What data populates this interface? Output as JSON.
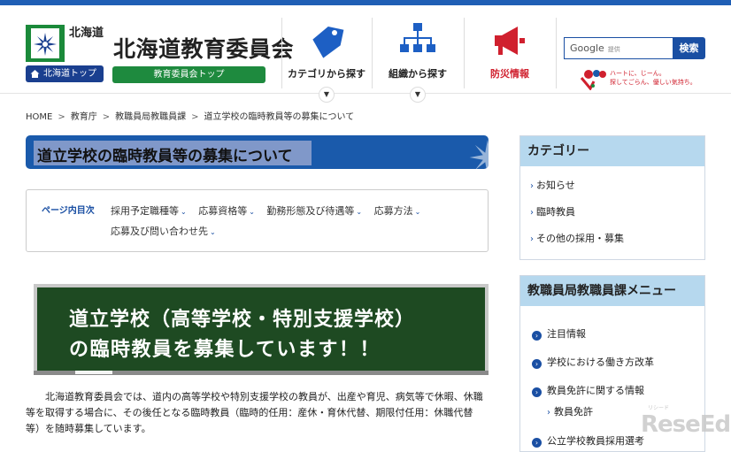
{
  "header": {
    "pref_name": "北海道",
    "pref_top_label": "北海道トップ",
    "board_title": "北海道教育委員会",
    "board_top_label": "教育委員会トップ",
    "nav": [
      {
        "label": "カテゴリから探す",
        "icon": "tag-icon"
      },
      {
        "label": "組織から探す",
        "icon": "org-chart-icon"
      },
      {
        "label": "防災情報",
        "icon": "megaphone-icon"
      }
    ],
    "search": {
      "brand": "Google",
      "brand_sub": "提供",
      "button_label": "検索"
    },
    "heart_line1": "ハートに、じーん。",
    "heart_line2": "探してごらん、優しい気持ち。"
  },
  "breadcrumb": [
    "HOME",
    "教育庁",
    "教職員局教職員課",
    "道立学校の臨時教員等の募集について"
  ],
  "page_title": "道立学校の臨時教員等の募集について",
  "toc": {
    "lead": "ページ内目次",
    "items": [
      "採用予定職種等",
      "応募資格等",
      "勤務形態及び待遇等",
      "応募方法",
      "応募及び問い合わせ先"
    ]
  },
  "banner": {
    "line1": "道立学校（高等学校・特別支援学校）",
    "line2": "の臨時教員を募集しています！！"
  },
  "body_text": "北海道教育委員会では、道内の高等学校や特別支援学校の教員が、出産や育児、病気等で休暇、休職等を取得する場合に、その後任となる臨時教員（臨時的任用：産休・育休代替、期限付任用：休職代替等）を随時募集しています。",
  "sidebar": {
    "category_heading": "カテゴリー",
    "categories": [
      "お知らせ",
      "臨時教員",
      "その他の採用・募集"
    ],
    "menu_heading": "教職員局教職員課メニュー",
    "menu": [
      "注目情報",
      "学校における働き方改革",
      "教員免許に関する情報"
    ],
    "menu_sub": [
      "教員免許"
    ],
    "menu_partial": "公立学校教員採用選考"
  },
  "watermark": {
    "text": "ReseEd",
    "sub": "リシード"
  },
  "colors": {
    "brand_blue": "#1a5aab",
    "green": "#1e8a3e",
    "sidebar_head": "#b6d8ee",
    "alert_red": "#d0202e"
  }
}
